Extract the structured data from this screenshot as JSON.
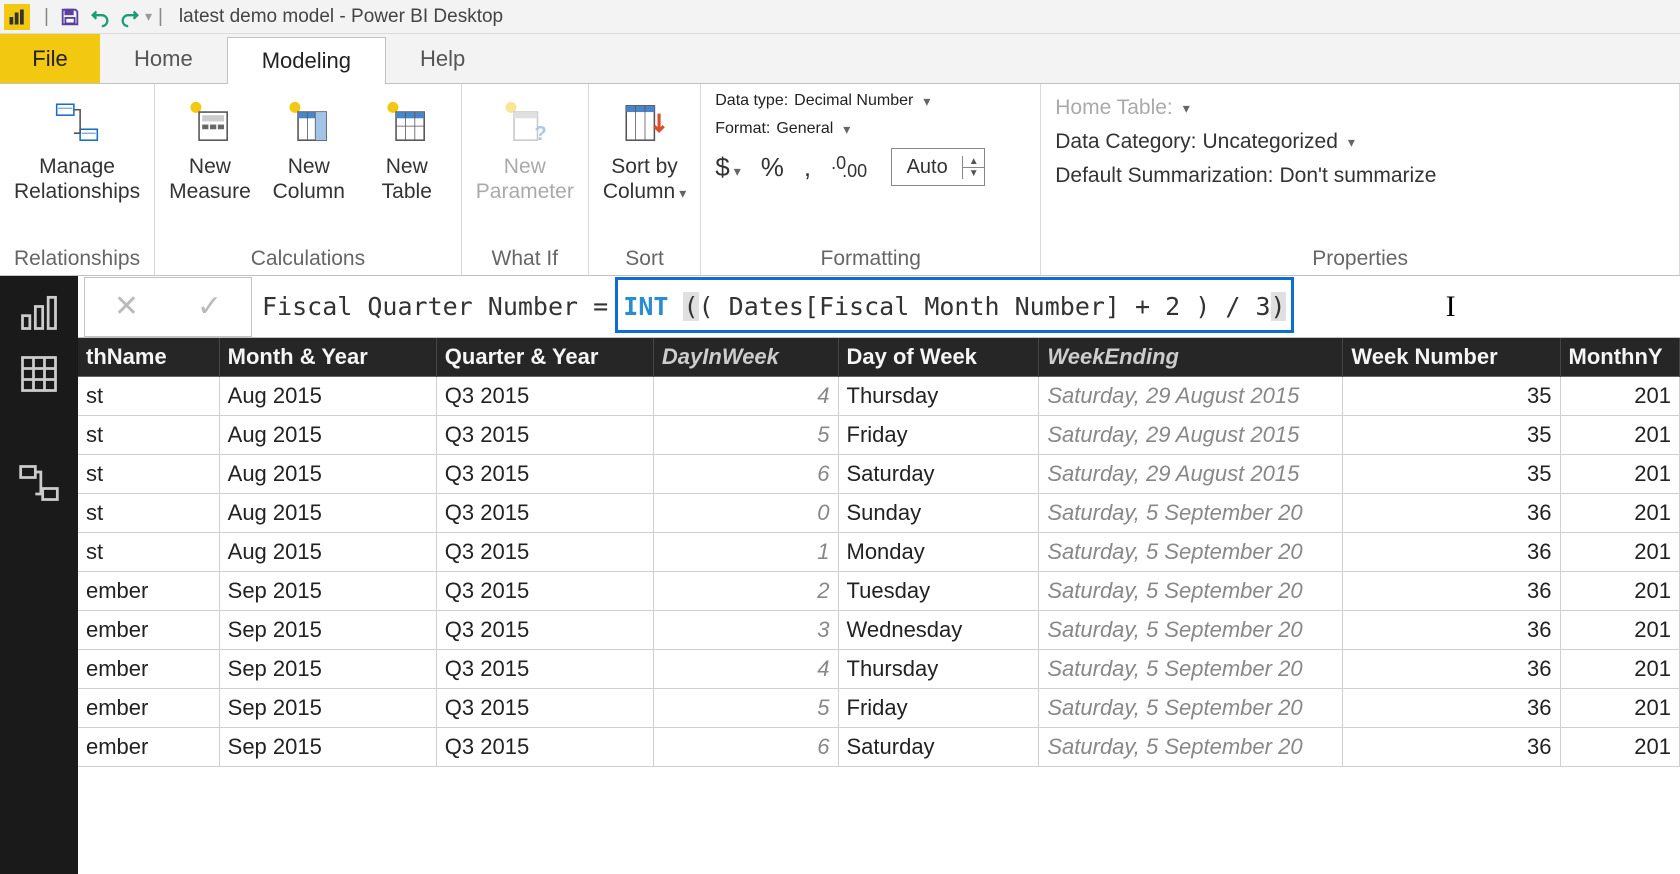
{
  "window": {
    "title": "latest demo model - Power BI Desktop"
  },
  "tabs": {
    "file": "File",
    "home": "Home",
    "modeling": "Modeling",
    "help": "Help"
  },
  "ribbon": {
    "groups": {
      "relationships": "Relationships",
      "calculations": "Calculations",
      "whatif": "What If",
      "sort": "Sort",
      "formatting": "Formatting",
      "properties": "Properties"
    },
    "buttons": {
      "manage_relationships_1": "Manage",
      "manage_relationships_2": "Relationships",
      "new_measure_1": "New",
      "new_measure_2": "Measure",
      "new_column_1": "New",
      "new_column_2": "Column",
      "new_table_1": "New",
      "new_table_2": "Table",
      "new_parameter_1": "New",
      "new_parameter_2": "Parameter",
      "sort_by_column_1": "Sort by",
      "sort_by_column_2": "Column"
    },
    "formatting": {
      "data_type_label": "Data type:",
      "data_type_value": "Decimal Number",
      "format_label": "Format:",
      "format_value": "General",
      "currency_sym": "$",
      "percent_sym": "%",
      "thousands_sym": ",",
      "decimal_icon": ".00",
      "decimal_value": "Auto"
    },
    "properties": {
      "home_table_label": "Home Table:",
      "data_category_label": "Data Category:",
      "data_category_value": "Uncategorized",
      "default_sum_label": "Default Summarization:",
      "default_sum_value": "Don't summarize"
    }
  },
  "formula": {
    "measure_name": "Fiscal Quarter Number",
    "equals": "=",
    "func": "INT",
    "expr_open": "(",
    "expr_body": " ( Dates[Fiscal Month Number] + 2 ) / 3 ",
    "expr_close": ")"
  },
  "table": {
    "columns": [
      "thName",
      "Month & Year",
      "Quarter & Year",
      "DayInWeek",
      "Day of Week",
      "WeekEnding",
      "Week Number",
      "MonthnY"
    ],
    "greyCols": [
      3,
      5
    ],
    "rows": [
      {
        "monthName": "st",
        "monthYear": "Aug 2015",
        "quarterYear": "Q3 2015",
        "dayInWeek": "4",
        "dayOfWeek": "Thursday",
        "weekEnding": "Saturday, 29 August 2015",
        "weekNumber": "35",
        "monthnY": "201"
      },
      {
        "monthName": "st",
        "monthYear": "Aug 2015",
        "quarterYear": "Q3 2015",
        "dayInWeek": "5",
        "dayOfWeek": "Friday",
        "weekEnding": "Saturday, 29 August 2015",
        "weekNumber": "35",
        "monthnY": "201"
      },
      {
        "monthName": "st",
        "monthYear": "Aug 2015",
        "quarterYear": "Q3 2015",
        "dayInWeek": "6",
        "dayOfWeek": "Saturday",
        "weekEnding": "Saturday, 29 August 2015",
        "weekNumber": "35",
        "monthnY": "201"
      },
      {
        "monthName": "st",
        "monthYear": "Aug 2015",
        "quarterYear": "Q3 2015",
        "dayInWeek": "0",
        "dayOfWeek": "Sunday",
        "weekEnding": "Saturday, 5 September 20",
        "weekNumber": "36",
        "monthnY": "201"
      },
      {
        "monthName": "st",
        "monthYear": "Aug 2015",
        "quarterYear": "Q3 2015",
        "dayInWeek": "1",
        "dayOfWeek": "Monday",
        "weekEnding": "Saturday, 5 September 20",
        "weekNumber": "36",
        "monthnY": "201"
      },
      {
        "monthName": "ember",
        "monthYear": "Sep 2015",
        "quarterYear": "Q3 2015",
        "dayInWeek": "2",
        "dayOfWeek": "Tuesday",
        "weekEnding": "Saturday, 5 September 20",
        "weekNumber": "36",
        "monthnY": "201"
      },
      {
        "monthName": "ember",
        "monthYear": "Sep 2015",
        "quarterYear": "Q3 2015",
        "dayInWeek": "3",
        "dayOfWeek": "Wednesday",
        "weekEnding": "Saturday, 5 September 20",
        "weekNumber": "36",
        "monthnY": "201"
      },
      {
        "monthName": "ember",
        "monthYear": "Sep 2015",
        "quarterYear": "Q3 2015",
        "dayInWeek": "4",
        "dayOfWeek": "Thursday",
        "weekEnding": "Saturday, 5 September 20",
        "weekNumber": "36",
        "monthnY": "201"
      },
      {
        "monthName": "ember",
        "monthYear": "Sep 2015",
        "quarterYear": "Q3 2015",
        "dayInWeek": "5",
        "dayOfWeek": "Friday",
        "weekEnding": "Saturday, 5 September 20",
        "weekNumber": "36",
        "monthnY": "201"
      },
      {
        "monthName": "ember",
        "monthYear": "Sep 2015",
        "quarterYear": "Q3 2015",
        "dayInWeek": "6",
        "dayOfWeek": "Saturday",
        "weekEnding": "Saturday, 5 September 20",
        "weekNumber": "36",
        "monthnY": "201"
      }
    ]
  }
}
